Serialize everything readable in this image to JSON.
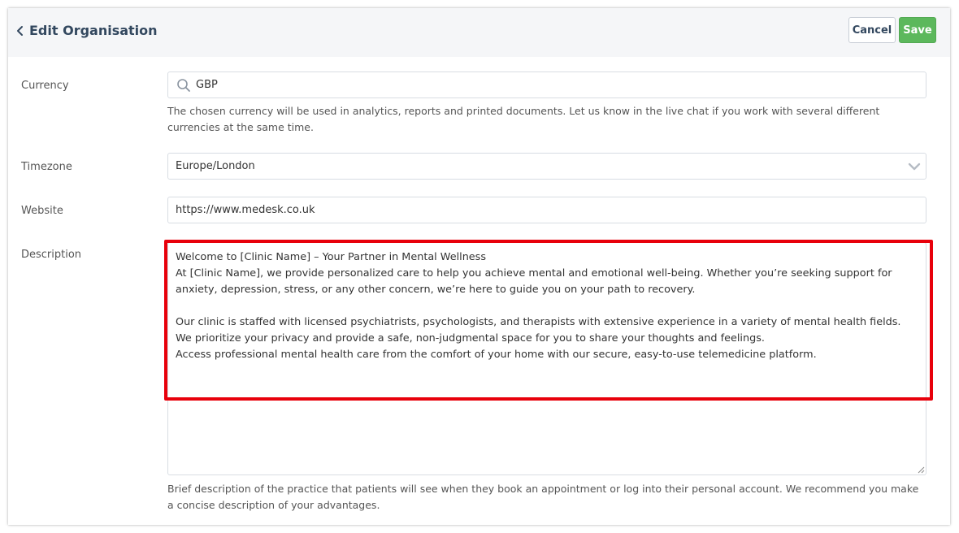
{
  "header": {
    "title": "Edit Organisation",
    "cancel_label": "Cancel",
    "save_label": "Save"
  },
  "form": {
    "currency": {
      "label": "Currency",
      "value": "GBP",
      "help": "The chosen currency will be used in analytics, reports and printed documents. Let us know in the live chat if you work with several different currencies at the same time."
    },
    "timezone": {
      "label": "Timezone",
      "value": "Europe/London"
    },
    "website": {
      "label": "Website",
      "value": "https://www.medesk.co.uk"
    },
    "description": {
      "label": "Description",
      "value": "Welcome to [Clinic Name] – Your Partner in Mental Wellness\nAt [Clinic Name], we provide personalized care to help you achieve mental and emotional well-being. Whether you’re seeking support for anxiety, depression, stress, or any other concern, we’re here to guide you on your path to recovery.\n\nOur clinic is staffed with licensed psychiatrists, psychologists, and therapists with extensive experience in a variety of mental health fields.\nWe prioritize your privacy and provide a safe, non-judgmental space for you to share your thoughts and feelings.\nAccess professional mental health care from the comfort of your home with our secure, easy-to-use telemedicine platform.",
      "help": "Brief description of the practice that patients will see when they book an appointment or log into their personal account. We recommend you make a concise description of your advantages."
    }
  },
  "colors": {
    "accent_save": "#5cb85c",
    "title_text": "#33485f",
    "highlight": "#e8000b"
  }
}
